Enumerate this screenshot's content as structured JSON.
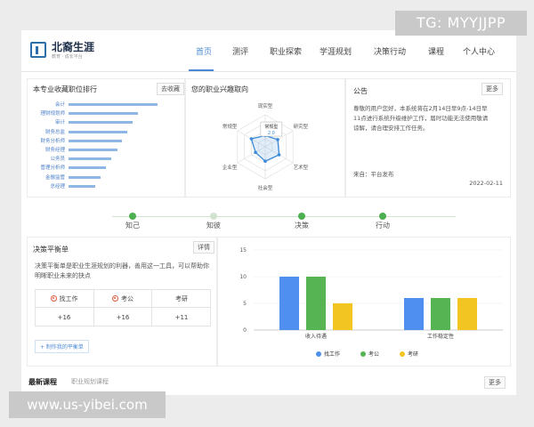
{
  "watermarks": {
    "tg": "TG: MYYJJPP",
    "site": "www.us-yibei.com"
  },
  "header": {
    "logo_title": "北裔生涯",
    "logo_sub": "教育 · 成长平台",
    "nav": [
      "首页",
      "测评",
      "职业探索",
      "学涯规划",
      "决策行动",
      "课程",
      "个人中心"
    ],
    "active_nav": "首页"
  },
  "jobs_panel": {
    "title": "本专业收藏职位排行",
    "button": "去收藏",
    "items": [
      {
        "label": "会计",
        "value": 1.0
      },
      {
        "label": "理财规划师",
        "value": 0.78
      },
      {
        "label": "审计",
        "value": 0.72
      },
      {
        "label": "财务总监",
        "value": 0.66
      },
      {
        "label": "财务分析师",
        "value": 0.6
      },
      {
        "label": "财务经理",
        "value": 0.55
      },
      {
        "label": "公务员",
        "value": 0.48
      },
      {
        "label": "管理分析师",
        "value": 0.42
      },
      {
        "label": "金融监管",
        "value": 0.36
      },
      {
        "label": "总经理",
        "value": 0.3
      }
    ]
  },
  "interest_panel": {
    "title": "您的职业兴趣取向",
    "axes": [
      "现实型",
      "研究型",
      "艺术型",
      "社会型",
      "企业型",
      "常规型"
    ],
    "tooltip_label": "常规型",
    "tooltip_value": "2.0",
    "chart_data": {
      "type": "radar",
      "categories": [
        "现实型",
        "研究型",
        "艺术型",
        "社会型",
        "企业型",
        "常规型"
      ],
      "values": [
        0.35,
        0.45,
        0.5,
        0.45,
        0.35,
        0.5
      ]
    }
  },
  "notice_panel": {
    "title": "公告",
    "button": "更多",
    "text": "尊敬的用户您好，本系统将在2月14日早9点-14日早11点进行系统升级维护工作，届时功能无法使用敬请谅解，请合理安排工作任务。",
    "from": "来自：平台发布",
    "date": "2022-02-11"
  },
  "stages": [
    "知己",
    "知彼",
    "决策",
    "行动"
  ],
  "decision_panel": {
    "title": "决策平衡单",
    "button": "详情",
    "desc": "决策平衡单是职业生涯规划的利器，善用这一工具，可以帮助你明晰职业未来的抉点",
    "columns": [
      {
        "label": "找工作",
        "icon": "target-icon",
        "score": "+16"
      },
      {
        "label": "考公",
        "icon": "target-icon",
        "score": "+16"
      },
      {
        "label": "考研",
        "icon": "",
        "score": "+11"
      }
    ],
    "make_button": "+ 制作我的平衡单"
  },
  "balance_chart": {
    "chart_data": {
      "type": "bar",
      "categories": [
        "收入待遇",
        "工作稳定性"
      ],
      "series": [
        {
          "name": "找工作",
          "color": "#4f8ff0",
          "values": [
            10,
            6
          ]
        },
        {
          "name": "考公",
          "color": "#56b552",
          "values": [
            10,
            6
          ]
        },
        {
          "name": "考研",
          "color": "#f2c522",
          "values": [
            5,
            6
          ]
        }
      ],
      "yticks": [
        "0",
        "5",
        "10",
        "15"
      ],
      "ylim": [
        0,
        15
      ]
    }
  },
  "bottom": {
    "title": "最新课程",
    "tab": "职业规划课程",
    "more": "更多"
  }
}
